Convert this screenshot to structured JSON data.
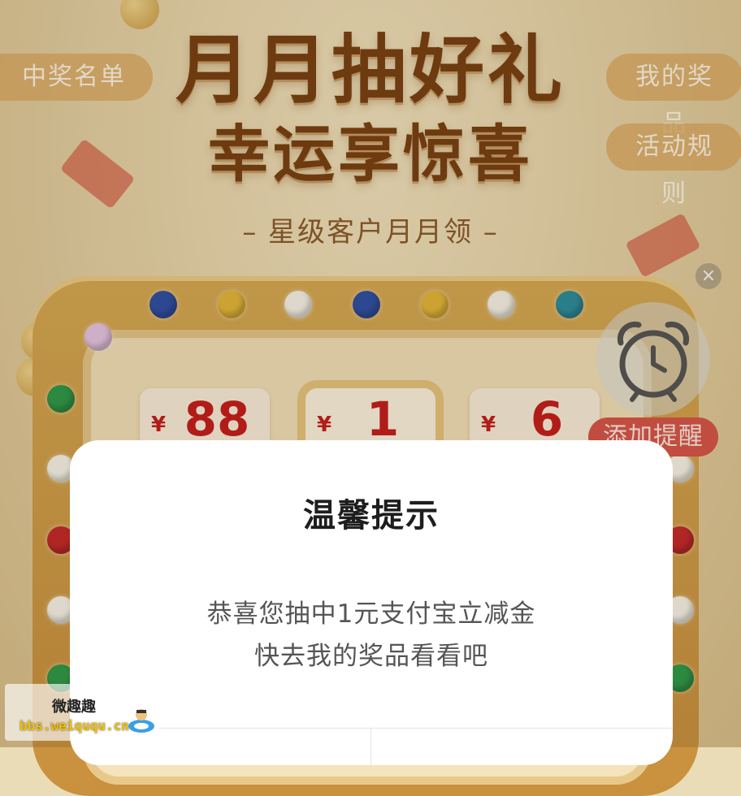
{
  "header": {
    "title_line1": "月月抽好礼",
    "title_line2": "幸运享惊喜",
    "subtitle": "– 星级客户月月领 –"
  },
  "side_buttons": {
    "winners_list": "中奖名单",
    "my_prizes": "我的奖品",
    "rules": "活动规则"
  },
  "prizes": [
    {
      "symbol": "¥",
      "value": "88"
    },
    {
      "symbol": "¥",
      "value": "1"
    },
    {
      "symbol": "¥",
      "value": "6"
    }
  ],
  "reminder": {
    "close_symbol": "×",
    "label": "添加提醒"
  },
  "dialog": {
    "title": "温馨提示",
    "message_line1": "恭喜您抽中1元支付宝立减金",
    "message_line2": "快去我的奖品看看吧"
  },
  "watermark": {
    "line1": "微趣趣",
    "line2": "bbs.weiququ.cn"
  },
  "colors": {
    "title": "#7a3f12",
    "prize_red": "#c81d1d",
    "remind_bg": "#d9554a",
    "pill_bg": "#deaa5f"
  },
  "icons": {
    "clock": "alarm-clock-icon",
    "close": "close-icon"
  }
}
